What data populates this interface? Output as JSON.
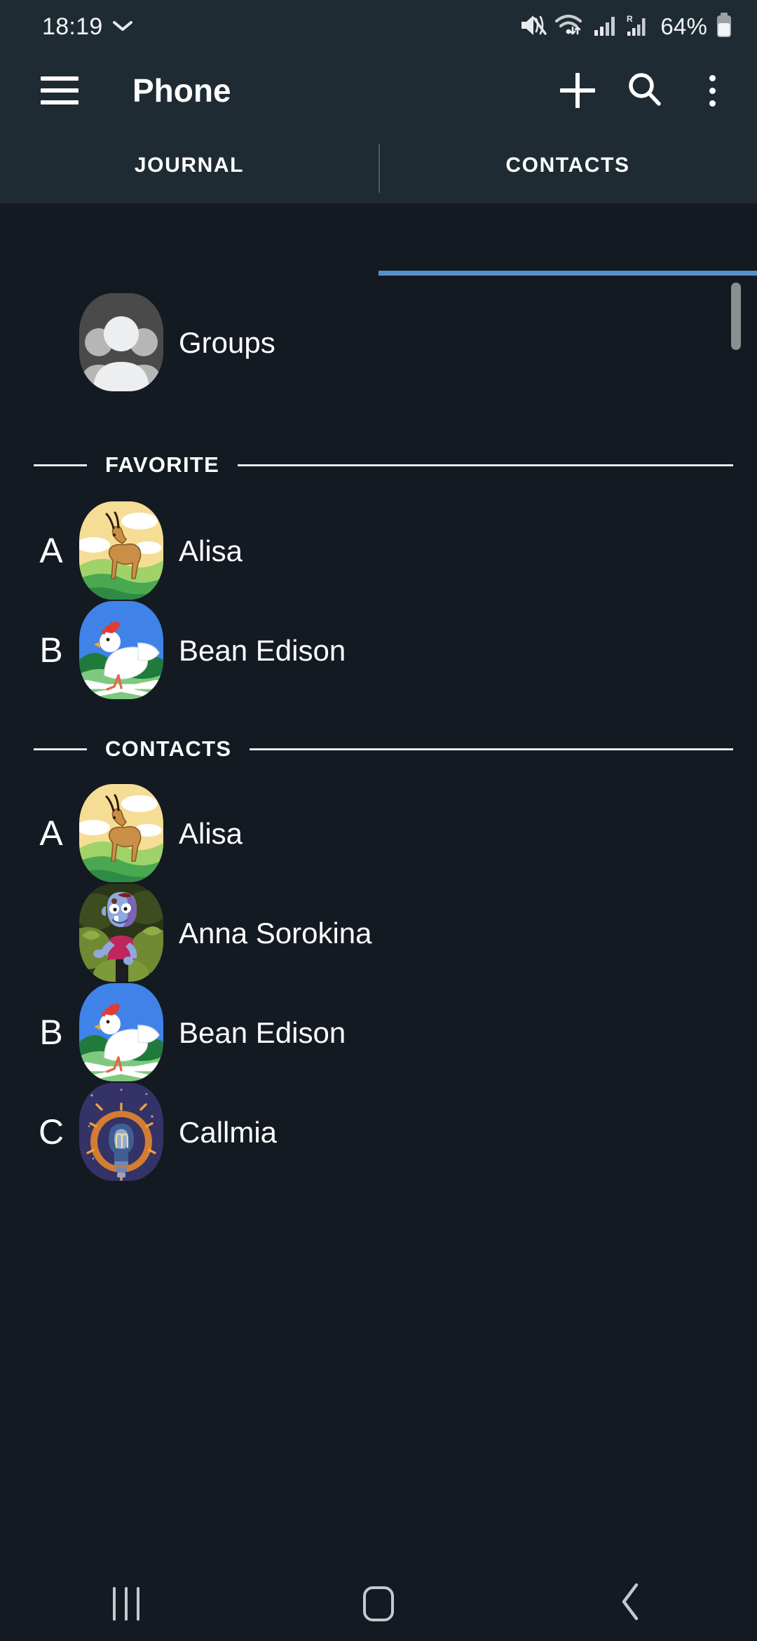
{
  "status_bar": {
    "time": "18:19",
    "battery_percent": "64%",
    "icons": [
      "notification-chevron-icon",
      "mute-icon",
      "wifi-icon",
      "signal-icon",
      "roaming-signal-icon",
      "battery-icon"
    ]
  },
  "app_bar": {
    "menu_icon": "hamburger-menu-icon",
    "title": "Phone",
    "actions": [
      {
        "name": "add-contact-button",
        "icon": "plus-icon"
      },
      {
        "name": "search-button",
        "icon": "search-icon"
      },
      {
        "name": "more-options-button",
        "icon": "kebab-menu-icon"
      }
    ]
  },
  "tabs": [
    {
      "label": "JOURNAL",
      "active": false
    },
    {
      "label": "CONTACTS",
      "active": true
    }
  ],
  "accent_color": "#5591c8",
  "header_bg": "#1f2b33",
  "content_bg": "#141a21",
  "groups_row": {
    "label": "Groups",
    "avatar": "groups-people-icon"
  },
  "sections": [
    {
      "title": "FAVORITE",
      "contacts": [
        {
          "index": "A",
          "name": "Alisa",
          "avatar": "gazelle-avatar"
        },
        {
          "index": "B",
          "name": "Bean Edison",
          "avatar": "chicken-avatar"
        }
      ]
    },
    {
      "title": "CONTACTS",
      "contacts": [
        {
          "index": "A",
          "name": "Alisa",
          "avatar": "gazelle-avatar"
        },
        {
          "index": "",
          "name": "Anna Sorokina",
          "avatar": "zombie-avatar"
        },
        {
          "index": "B",
          "name": "Bean Edison",
          "avatar": "chicken-avatar"
        },
        {
          "index": "C",
          "name": "Callmia",
          "avatar": "lightbulb-avatar"
        }
      ]
    }
  ],
  "nav_bar": [
    {
      "name": "recents-button",
      "icon": "recents-icon"
    },
    {
      "name": "home-button",
      "icon": "home-icon"
    },
    {
      "name": "back-button",
      "icon": "back-chevron-icon"
    }
  ]
}
